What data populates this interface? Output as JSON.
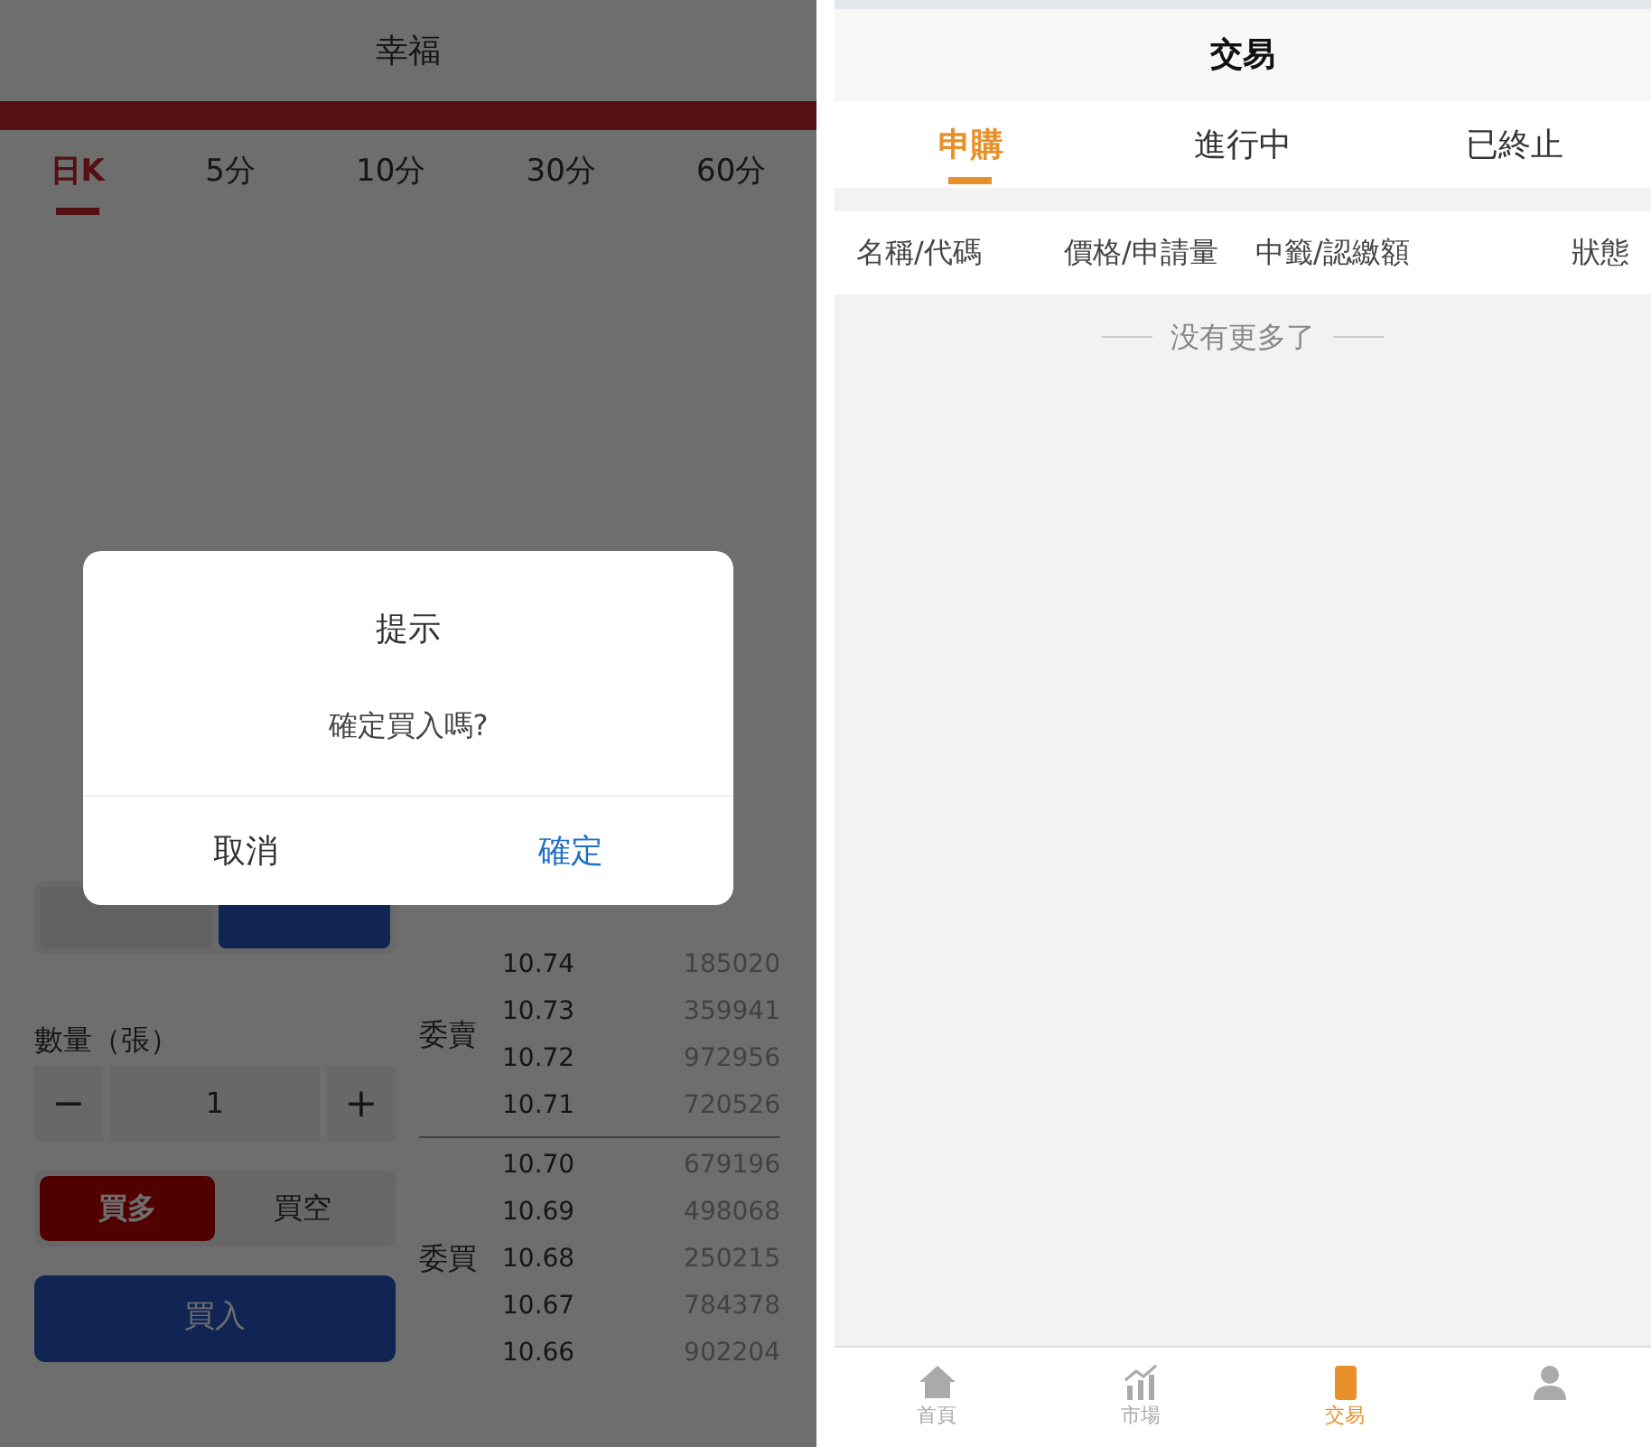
{
  "left_screen": {
    "title": "幸福",
    "period_tabs": [
      {
        "label": "日K",
        "selected": true
      },
      {
        "label": "5分",
        "selected": false
      },
      {
        "label": "10分",
        "selected": false
      },
      {
        "label": "30分",
        "selected": false
      },
      {
        "label": "60分",
        "selected": false
      }
    ],
    "order_type": [
      {
        "selected": false
      },
      {
        "selected": true
      }
    ],
    "quantity": {
      "label": "數量（張）",
      "minus": "−",
      "value": "1",
      "plus": "+"
    },
    "direction": [
      {
        "label": "買多",
        "selected": true
      },
      {
        "label": "買空",
        "selected": false
      }
    ],
    "submit": "買入",
    "asks": {
      "label": "委賣",
      "rows": [
        {
          "price": "10.74",
          "volume": "185020"
        },
        {
          "price": "10.73",
          "volume": "359941"
        },
        {
          "price": "10.72",
          "volume": "972956"
        },
        {
          "price": "10.71",
          "volume": "720526"
        }
      ]
    },
    "bids": {
      "label": "委買",
      "rows": [
        {
          "price": "10.70",
          "volume": "679196"
        },
        {
          "price": "10.69",
          "volume": "498068"
        },
        {
          "price": "10.68",
          "volume": "250215"
        },
        {
          "price": "10.67",
          "volume": "784378"
        },
        {
          "price": "10.66",
          "volume": "902204"
        }
      ]
    },
    "dialog": {
      "title": "提示",
      "message": "確定買入嗎?",
      "cancel": "取消",
      "confirm": "確定"
    }
  },
  "right_screen": {
    "title": "交易",
    "tabs": [
      {
        "label": "申購",
        "selected": true
      },
      {
        "label": "進行中",
        "selected": false
      },
      {
        "label": "已終止",
        "selected": false
      }
    ],
    "table": {
      "columns": [
        "名稱/代碼",
        "價格/申請量",
        "中籤/認繳額",
        "狀態"
      ]
    },
    "empty_note": "没有更多了",
    "bottom_nav": [
      {
        "kind": "home",
        "label": "首頁",
        "selected": false
      },
      {
        "kind": "market",
        "label": "市場",
        "selected": false
      },
      {
        "kind": "trade",
        "label": "交易",
        "selected": true
      },
      {
        "kind": "profile",
        "selected": false
      }
    ]
  }
}
